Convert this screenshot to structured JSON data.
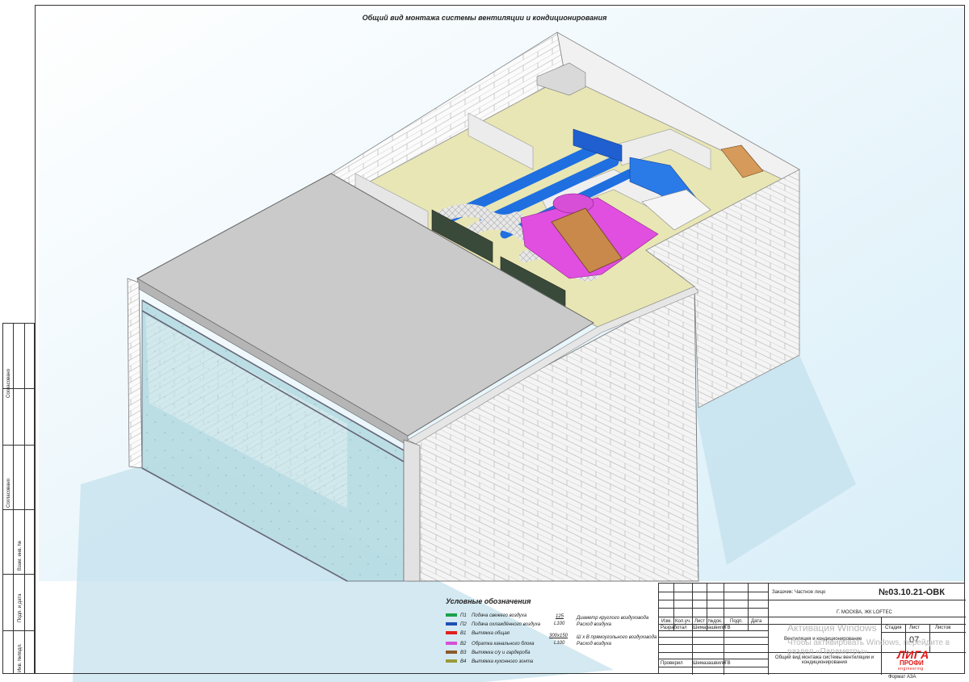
{
  "sheet": {
    "title": "Общий вид монтажа системы вентиляции и кондиционирования",
    "format_label": "Формат А3А"
  },
  "side_stamp": {
    "agreed": "Согласовано",
    "agreed2": "Согласовано",
    "inv_zam": "Взам. инв. №",
    "sign_date": "Подп. и дата",
    "inv_podl": "Инв. №подл."
  },
  "legend": {
    "title": "Условные обозначения",
    "items": [
      {
        "code": "П1",
        "label": "Подача свежего воздуха",
        "color": "#1aa14a"
      },
      {
        "code": "П2",
        "label": "Подача охлаждённого воздуха",
        "color": "#1f4fb5"
      },
      {
        "code": "В1",
        "label": "Вытяжка общая",
        "color": "#e21f1f"
      },
      {
        "code": "В2",
        "label": "Обратка канального блока",
        "color": "#d64fd6"
      },
      {
        "code": "В3",
        "label": "Вытяжка с/у и гардероба",
        "color": "#8a5a2b"
      },
      {
        "code": "В4",
        "label": "Вытяжка кухонного зонта",
        "color": "#9a9a3a"
      }
    ],
    "round_top": "125",
    "round_bottom": "L100",
    "round_desc1": "Диаметр круглого воздуховода",
    "round_desc2": "Расход воздуха",
    "rect_top": "300х150",
    "rect_bottom": "L100",
    "rect_desc1": "Ш х В прямоугольного воздуховода",
    "rect_desc2": "Расход воздуха"
  },
  "title_block": {
    "customer": "Заказчик: Частное лицо",
    "doc_number": "№03.10.21-ОВК",
    "location": "Г. МОСКВА, ЖК LOFTEC",
    "hdr_izm": "Изм.",
    "hdr_kol": "Кол.уч.",
    "hdr_list": "Лист",
    "hdr_ndok": "№док.",
    "hdr_podp": "Подп.",
    "hdr_data": "Дата",
    "developed": "Разработал",
    "developer_name": "Шемазашвили",
    "developer_initials": "ТВ",
    "checked": "Проверил",
    "checker_name": "Шемазашвили",
    "checker_initials": "ТВ",
    "section": "Вентиляция и кондиционирование",
    "stage_label": "Стадия",
    "sheet_label": "Лист",
    "sheets_label": "Листов",
    "sheet_num": "07",
    "drawing_title": "Общий вид монтажа системы вентиляции и кондиционирования",
    "company_liga": "ЛИГА",
    "company_profi": "ПРОФИ",
    "company_sub": "engineering"
  },
  "watermark": {
    "line1": "Активация Windows",
    "line2": "Чтобы активировать Windows, перейдите в раздел «Параметры»"
  },
  "colors": {
    "supply_fresh": "#1aa14a",
    "supply_cooled": "#1f6fe0",
    "return_block": "#d64fd6",
    "wc_exhaust": "#c8894a",
    "floor": "#e8e6b4",
    "roof": "#c9c9c9",
    "glass": "#bfe2ea",
    "sky": "#cde9f5"
  }
}
